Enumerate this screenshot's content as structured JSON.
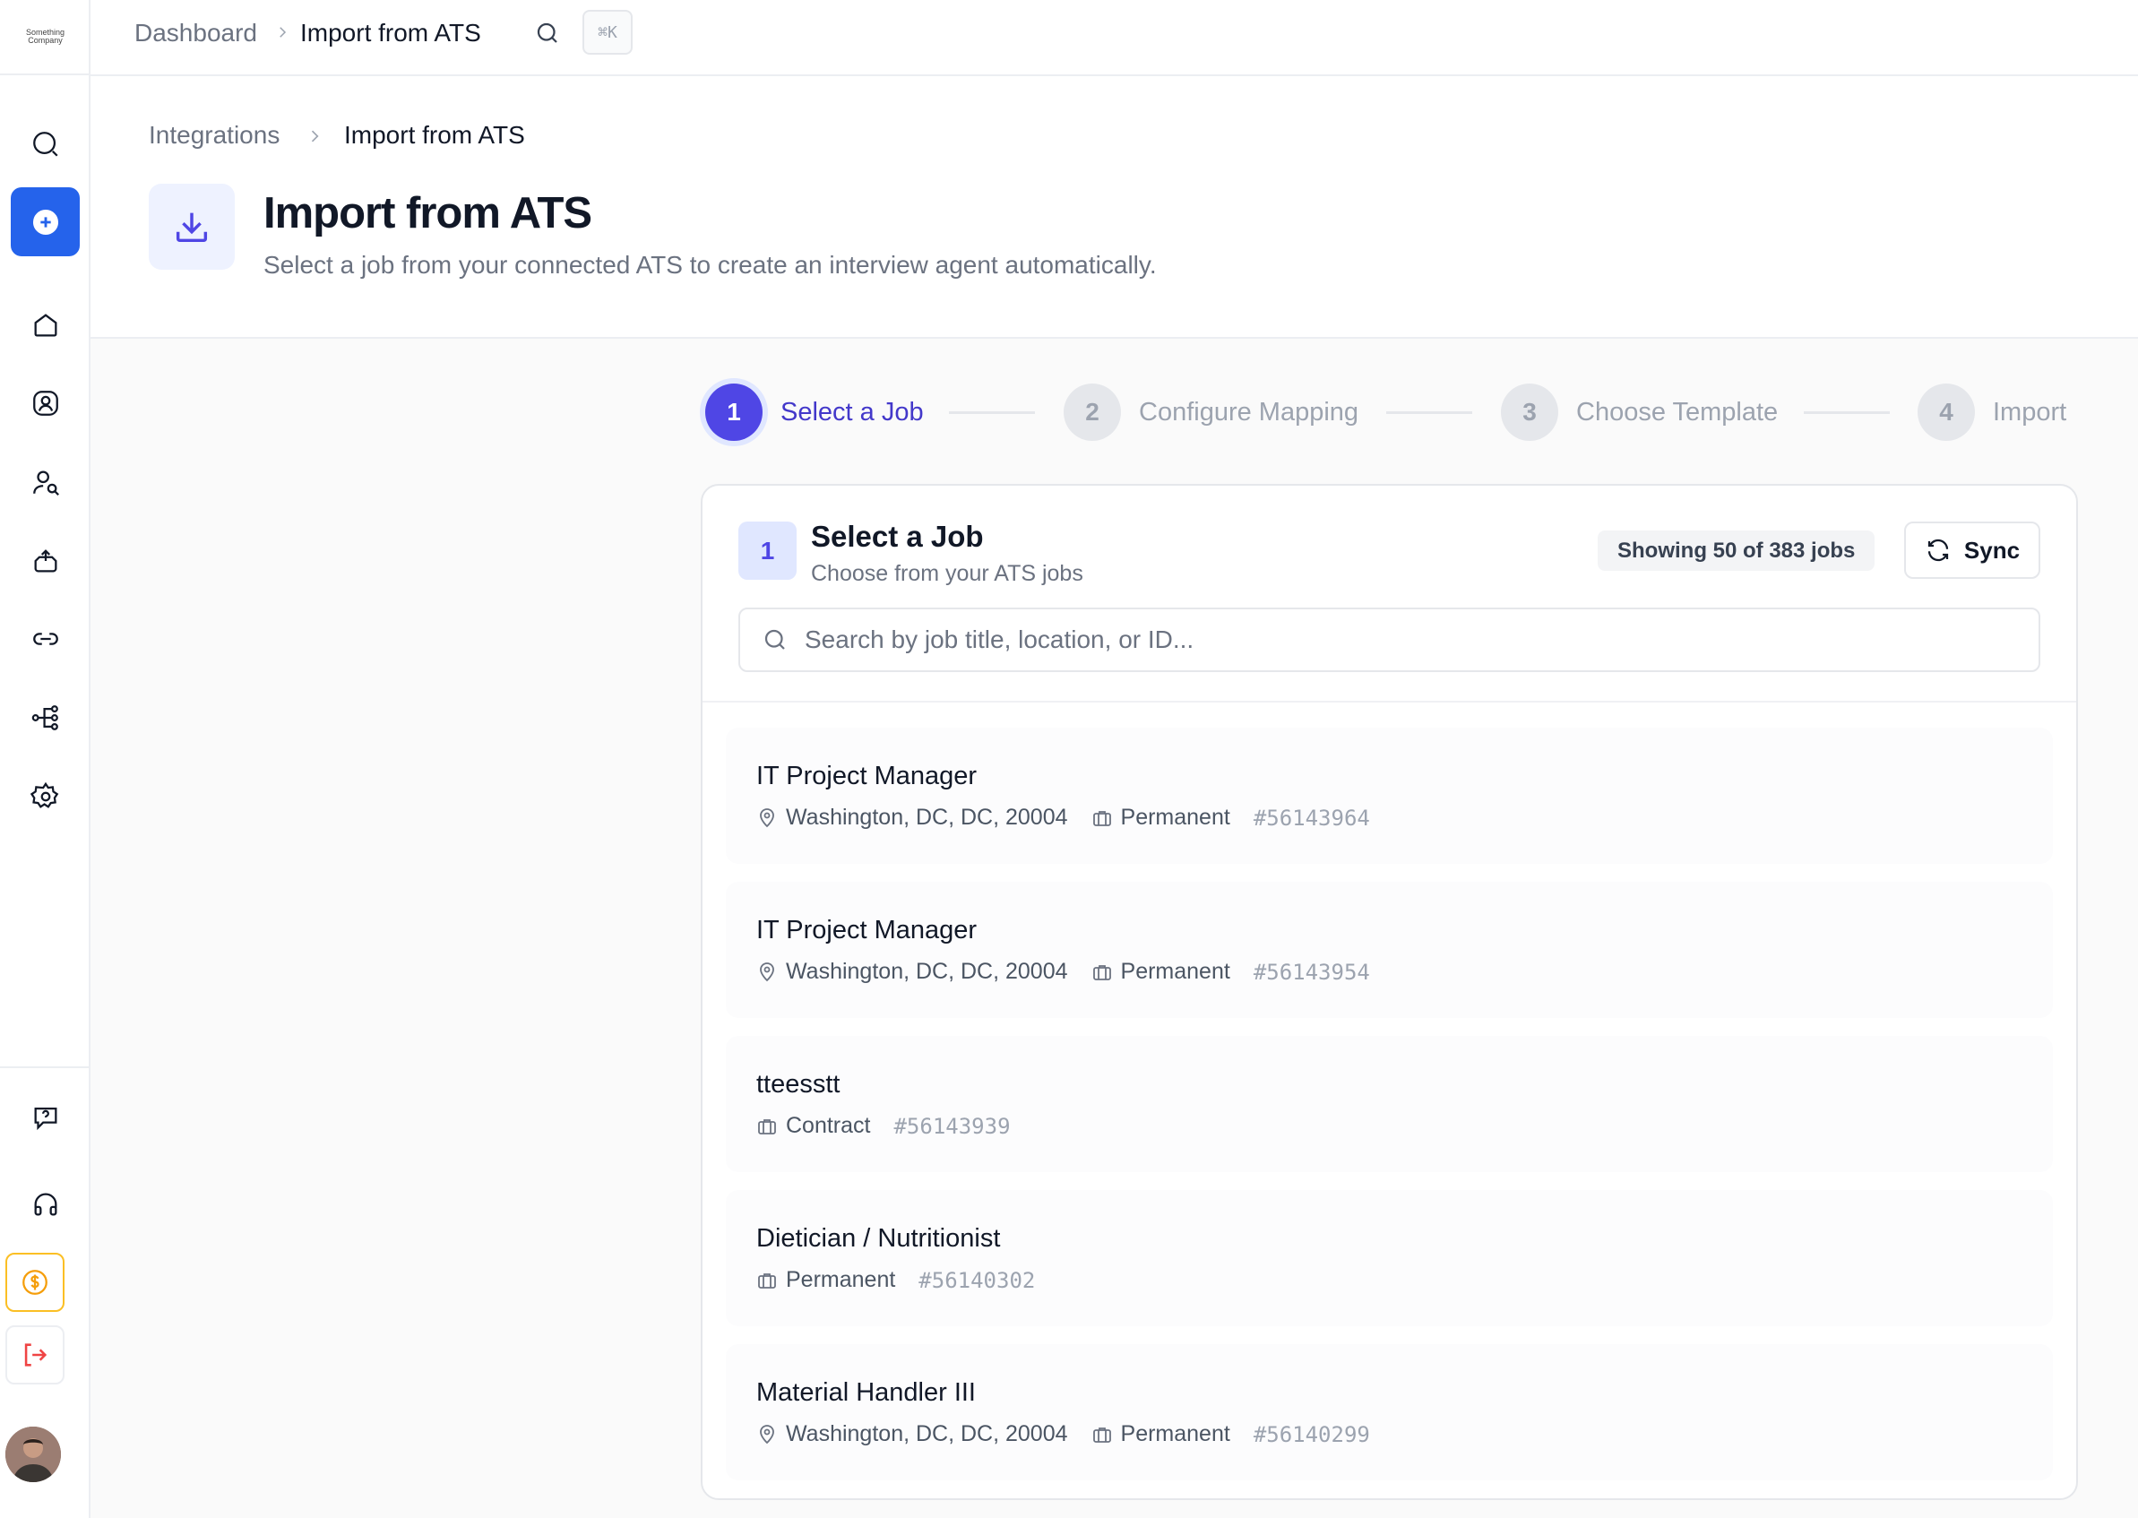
{
  "app": {
    "logo_text": "Something Company"
  },
  "breadcrumb_top": [
    "Dashboard",
    "Import from ATS"
  ],
  "shortcut": "⌘K",
  "breadcrumb_page": [
    "Integrations",
    "Import from ATS"
  ],
  "page": {
    "title": "Import from ATS",
    "subtitle": "Select a job from your connected ATS to create an interview agent automatically."
  },
  "steps": [
    {
      "number": "1",
      "label": "Select a Job",
      "active": true
    },
    {
      "number": "2",
      "label": "Configure Mapping",
      "active": false
    },
    {
      "number": "3",
      "label": "Choose Template",
      "active": false
    },
    {
      "number": "4",
      "label": "Import",
      "active": false
    }
  ],
  "card": {
    "step_number": "1",
    "title": "Select a Job",
    "subtitle": "Choose from your ATS jobs",
    "count_text": "Showing 50 of 383 jobs",
    "sync_label": "Sync",
    "search_placeholder": "Search by job title, location, or ID..."
  },
  "jobs": [
    {
      "title": "IT Project Manager",
      "location": "Washington, DC, DC, 20004",
      "type": "Permanent",
      "id": "#56143964"
    },
    {
      "title": "IT Project Manager",
      "location": "Washington, DC, DC, 20004",
      "type": "Permanent",
      "id": "#56143954"
    },
    {
      "title": "tteesstt",
      "location": "",
      "type": "Contract",
      "id": "#56143939"
    },
    {
      "title": "Dietician / Nutritionist",
      "location": "",
      "type": "Permanent",
      "id": "#56140302"
    },
    {
      "title": "Material Handler III",
      "location": "Washington, DC, DC, 20004",
      "type": "Permanent",
      "id": "#56140299"
    }
  ],
  "colors": {
    "accent": "#4f46e5",
    "primary_button": "#2563eb",
    "credit": "#f59e0b",
    "logout": "#ef4444"
  }
}
